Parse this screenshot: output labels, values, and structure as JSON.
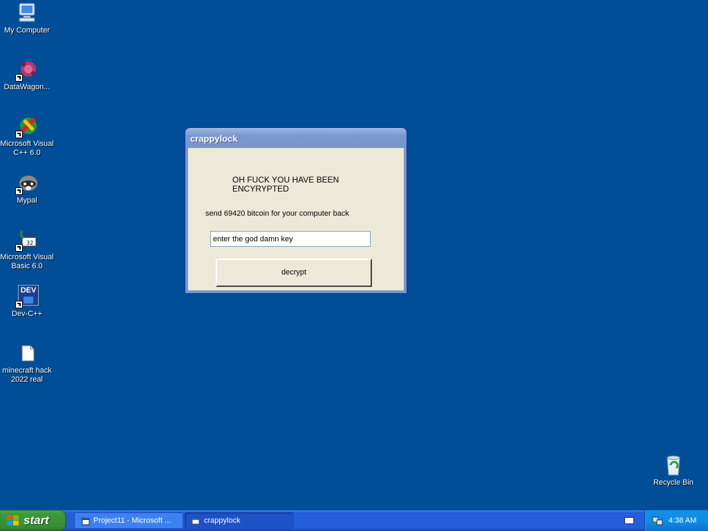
{
  "desktop": {
    "icons": [
      {
        "label_1": "My Computer",
        "label_2": ""
      },
      {
        "label_1": "DataWagon...",
        "label_2": ""
      },
      {
        "label_1": "Microsoft Visual",
        "label_2": "C++ 6.0"
      },
      {
        "label_1": "Mypal",
        "label_2": ""
      },
      {
        "label_1": "Microsoft Visual",
        "label_2": "Basic 6.0"
      },
      {
        "label_1": "Dev-C++",
        "label_2": ""
      },
      {
        "label_1": "minecraft hack",
        "label_2": "2022 real"
      },
      {
        "label_1": "Recycle Bin",
        "label_2": ""
      }
    ],
    "devcpp_badge": "DEV"
  },
  "window": {
    "title": "crappylock",
    "heading_line1": "OH FUCK YOU HAVE BEEN",
    "heading_line2": "ENCYRYPTED",
    "message": "send 69420 bitcoin for your computer back",
    "key_input_value": "enter the god damn key",
    "decrypt_button": "decrypt"
  },
  "taskbar": {
    "start_label": "start",
    "tasks": [
      {
        "label": "Project11 - Microsoft ...",
        "active": false
      },
      {
        "label": "crappylock",
        "active": true
      }
    ],
    "clock": "4:38 AM"
  },
  "colors": {
    "desktop_bg": "#004e98",
    "taskbar_blue": "#245edb",
    "start_green": "#388e34",
    "tray_blue": "#0f8ee6",
    "window_face": "#ece9d8"
  }
}
